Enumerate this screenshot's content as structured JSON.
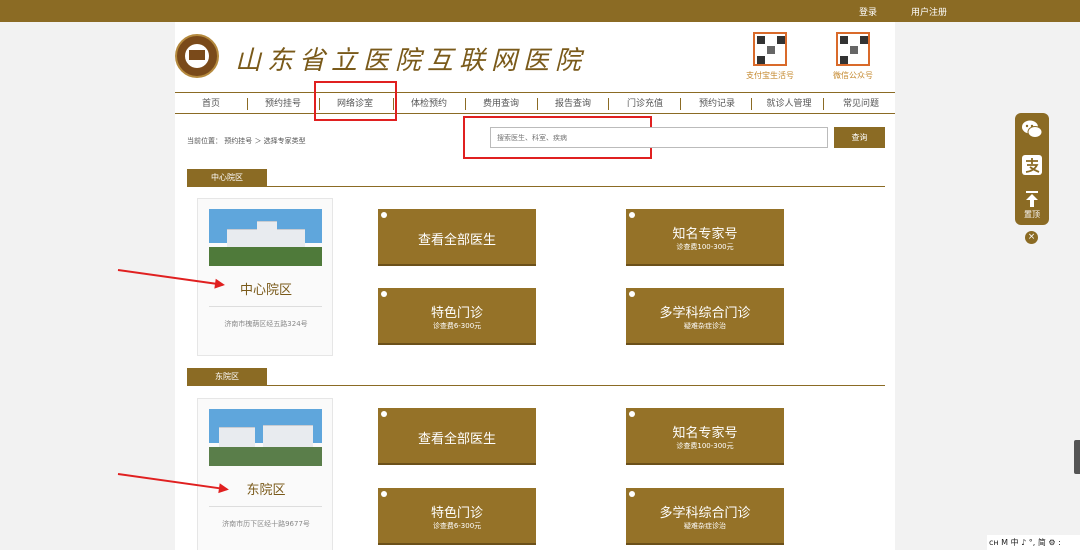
{
  "topbar": {
    "login": "登录",
    "register": "用户注册"
  },
  "header": {
    "brand": "山东省立医院互联网医院",
    "qr_alipay": "支付宝生活号",
    "qr_wechat": "微信公众号"
  },
  "nav": {
    "items": [
      "首页",
      "预约挂号",
      "网络诊室",
      "体检预约",
      "费用查询",
      "报告查询",
      "门诊充值",
      "预约记录",
      "就诊人管理",
      "常见问题"
    ]
  },
  "breadcrumb": {
    "label": "当前位置：",
    "path": "预约挂号 ＞ 选择专家类型"
  },
  "search": {
    "placeholder": "搜索医生、科室、疾病",
    "button": "查询"
  },
  "sections": [
    {
      "tab": "中心院区",
      "campus_name": "中心院区",
      "address": "济南市槐荫区经五路324号",
      "tiles": [
        {
          "title": "查看全部医生",
          "subtitle": ""
        },
        {
          "title": "知名专家号",
          "subtitle": "诊查费100-300元"
        },
        {
          "title": "特色门诊",
          "subtitle": "诊查费6-300元"
        },
        {
          "title": "多学科综合门诊",
          "subtitle": "疑难杂症诊治"
        }
      ]
    },
    {
      "tab": "东院区",
      "campus_name": "东院区",
      "address": "济南市历下区经十路9677号",
      "tiles": [
        {
          "title": "查看全部医生",
          "subtitle": ""
        },
        {
          "title": "知名专家号",
          "subtitle": "诊查费100-300元"
        },
        {
          "title": "特色门诊",
          "subtitle": "诊查费6-300元"
        },
        {
          "title": "多学科综合门诊",
          "subtitle": "疑难杂症诊治"
        }
      ]
    }
  ],
  "sidebar": {
    "wechat_icon": "wechat-icon",
    "alipay_icon": "alipay-icon",
    "top_label": "置顶",
    "close": "×"
  },
  "ime": {
    "text": "ᴄʜ M 中 ♪ °, 简 ⚙ :"
  },
  "colors": {
    "brand": "#8b6b24",
    "tile": "#957228",
    "annotation": "#e02020"
  }
}
